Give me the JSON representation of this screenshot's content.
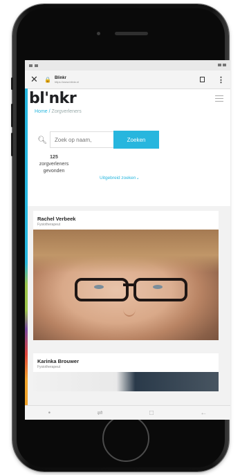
{
  "browser": {
    "tab_title": "Blinkr",
    "url": "https://www.blinkr.nl"
  },
  "site": {
    "logo": "bl'nkr"
  },
  "breadcrumb": {
    "home": "Home",
    "separator": "/",
    "current": "Zorgverleners"
  },
  "search": {
    "placeholder": "Zoek op naam,",
    "button_label": "Zoeken"
  },
  "results": {
    "count": "125",
    "line1": "zorgverleners",
    "line2": "gevonden",
    "advanced_search": "Uitgebreid zoeken"
  },
  "cards": [
    {
      "name": "Rachel Verbeek",
      "role": "Fysiotherapeut"
    },
    {
      "name": "Karinka Brouwer",
      "role": "Fysiotherapeut"
    }
  ],
  "colors": {
    "accent": "#27b6de"
  },
  "icons": {
    "close": "close-icon",
    "lock": "lock-icon",
    "bookmark": "bookmark-icon",
    "menu": "kebab-menu-icon",
    "hamburger": "hamburger-icon",
    "search": "search-icon"
  }
}
